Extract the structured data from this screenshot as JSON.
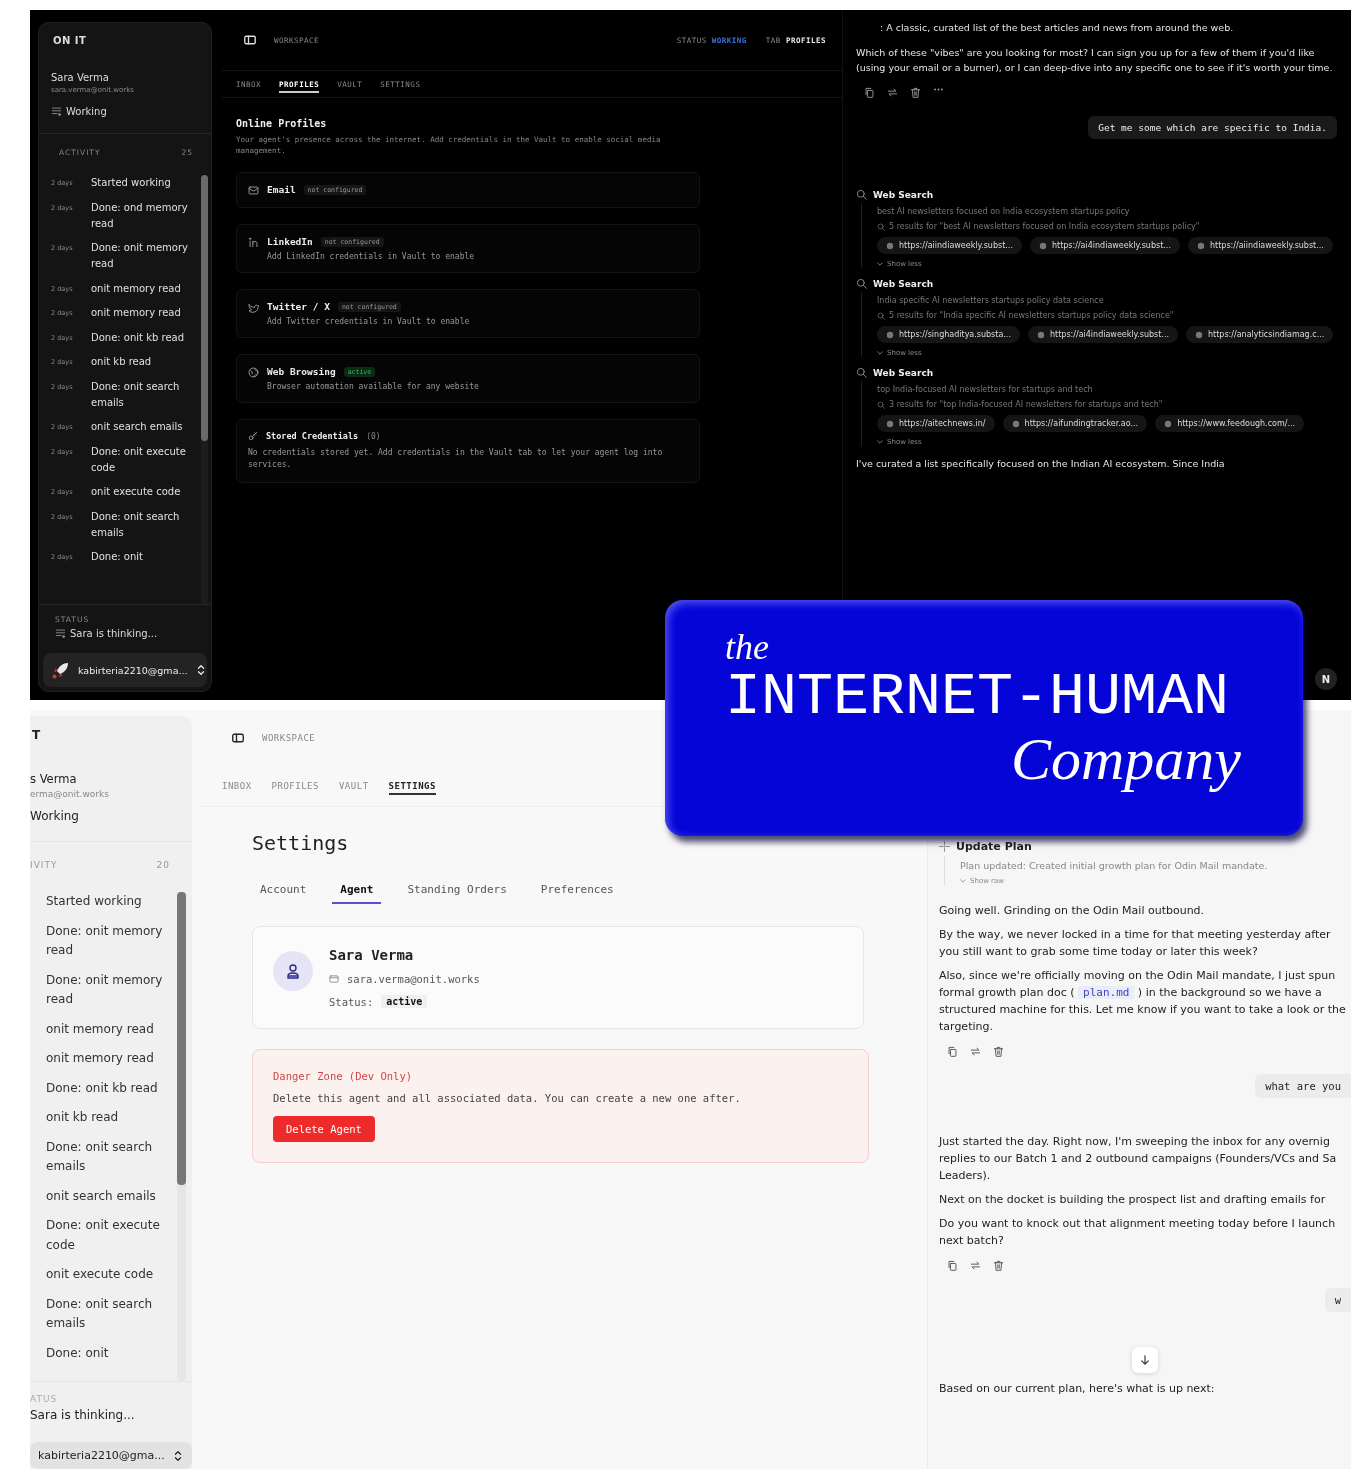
{
  "dark_screen": {
    "sidebar": {
      "brand": "ON IT",
      "user_name": "Sara Verma",
      "user_email": "sara.verma@onit.works",
      "user_status": "Working",
      "activity_title": "ACTIVITY",
      "activity_count": "25",
      "activity": [
        {
          "time": "2 days",
          "text": "Started working"
        },
        {
          "time": "2 days",
          "text": "Done: ond memory read"
        },
        {
          "time": "2 days",
          "text": "Done: onit memory read"
        },
        {
          "time": "2 days",
          "text": "onit memory read"
        },
        {
          "time": "2 days",
          "text": "onit memory read"
        },
        {
          "time": "2 days",
          "text": "Done: onit kb read"
        },
        {
          "time": "2 days",
          "text": "onit kb read"
        },
        {
          "time": "2 days",
          "text": "Done: onit search emails"
        },
        {
          "time": "2 days",
          "text": "onit search emails"
        },
        {
          "time": "2 days",
          "text": "Done: onit execute code"
        },
        {
          "time": "2 days",
          "text": "onit execute code"
        },
        {
          "time": "2 days",
          "text": "Done: onit search emails"
        },
        {
          "time": "2 days",
          "text": "Done: onit"
        }
      ],
      "status_title": "STATUS",
      "status_text": "Sara is thinking...",
      "account": "kabirteria2210@gma..."
    },
    "header": {
      "title": "WORKSPACE",
      "status_label": "STATUS",
      "status_value": "WORKING",
      "tab_label": "TAB",
      "tab_value": "PROFILES"
    },
    "tabs": [
      {
        "label": "INBOX",
        "selected": false
      },
      {
        "label": "PROFILES",
        "selected": true
      },
      {
        "label": "VAULT",
        "selected": false
      },
      {
        "label": "SETTINGS",
        "selected": false
      }
    ],
    "profiles": {
      "title": "Online Profiles",
      "description": "Your agent's presence across the internet. Add credentials in the Vault to enable social media management.",
      "cards": [
        {
          "name": "Email",
          "badge": "not configured",
          "active": false
        },
        {
          "name": "LinkedIn",
          "badge": "not configured",
          "active": false,
          "note": "Add LinkedIn credentials in Vault to enable"
        },
        {
          "name": "Twitter / X",
          "badge": "not configured",
          "active": false,
          "note": "Add Twitter credentials in Vault to enable"
        },
        {
          "name": "Web Browsing",
          "badge": "active",
          "active": true,
          "note": "Browser automation available for any website"
        }
      ],
      "credentials": {
        "title": "Stored Credentials",
        "count": "(0)",
        "text": "No credentials stored yet. Add credentials in the Vault tab to let your agent log into services."
      }
    },
    "chat": {
      "items": [
        {
          "kind": "list_line",
          "text": ": A classic, curated list of the best articles and news from around the web."
        },
        {
          "kind": "text",
          "text": "Which of these \"vibes\" are you looking for most? I can sign you up for a few of them if you'd like (using your email or a burner), or I can deep-dive into any specific one to see if it's worth your time."
        },
        {
          "kind": "actions",
          "more": true
        },
        {
          "kind": "user",
          "text": "Get me some which are specific to India."
        },
        {
          "kind": "search",
          "title": "Web Search",
          "query": "best AI newsletters focused on India ecosystem startups policy",
          "results": "5 results for \"best AI newsletters focused on India ecosystem startups policy\"",
          "links": [
            "https://aiindiaweekly.subst...",
            "https://ai4indiaweekly.subst...",
            "https://aiindiaweekly.subst..."
          ],
          "toggle": "Show less"
        },
        {
          "kind": "search",
          "title": "Web Search",
          "query": "India specific AI newsletters startups policy data science",
          "results": "5 results for \"India specific AI newsletters startups policy data science\"",
          "links": [
            "https://singhaditya.substa...",
            "https://ai4indiaweekly.subst...",
            "https://analyticsindiamag.c..."
          ],
          "toggle": "Show less"
        },
        {
          "kind": "search",
          "title": "Web Search",
          "query": "top India-focused AI newsletters for startups and tech",
          "results": "3 results for \"top India-focused AI newsletters for startups and tech\"",
          "links": [
            "https://aitechnews.in/",
            "https://aifundingtracker.ao...",
            "https://www.feedough.com/..."
          ],
          "toggle": "Show less"
        },
        {
          "kind": "text",
          "text": "I've curated a list specifically focused on the Indian AI ecosystem. Since India"
        }
      ]
    },
    "avatar_button": "N"
  },
  "light_screen": {
    "sidebar": {
      "brand": "T",
      "user_name": "s Verma",
      "user_email": "erma@onit.works",
      "user_status": "Working",
      "activity_title": "IVITY",
      "activity_count": "20",
      "activity": [
        {
          "text": "Started working"
        },
        {
          "text": "Done: onit memory read"
        },
        {
          "text": "Done: onit memory read"
        },
        {
          "text": "onit memory read"
        },
        {
          "text": "onit memory read"
        },
        {
          "text": "Done: onit kb read"
        },
        {
          "text": "onit kb read"
        },
        {
          "text": "Done: onit search emails"
        },
        {
          "text": "onit search emails"
        },
        {
          "text": "Done: onit execute code"
        },
        {
          "text": "onit execute code"
        },
        {
          "text": "Done: onit search emails"
        },
        {
          "text": "Done: onit"
        }
      ],
      "status_title": "ATUS",
      "status_text": "Sara is thinking...",
      "account": "kabirteria2210@gma..."
    },
    "header": {
      "title": "WORKSPACE"
    },
    "tabs": [
      {
        "label": "INBOX",
        "selected": false
      },
      {
        "label": "PROFILES",
        "selected": false
      },
      {
        "label": "VAULT",
        "selected": false
      },
      {
        "label": "SETTINGS",
        "selected": true
      }
    ],
    "settings": {
      "title": "Settings",
      "tabs": [
        {
          "label": "Account",
          "selected": false
        },
        {
          "label": "Agent",
          "selected": true
        },
        {
          "label": "Standing Orders",
          "selected": false
        },
        {
          "label": "Preferences",
          "selected": false
        }
      ],
      "agent": {
        "name": "Sara Verma",
        "email": "sara.verma@onit.works",
        "status_label": "Status:",
        "status_value": "active"
      },
      "danger": {
        "title": "Danger Zone (Dev Only)",
        "text": "Delete this agent and all associated data. You can create a new one after.",
        "button": "Delete Agent"
      }
    },
    "chat": {
      "items": [
        {
          "kind": "plan",
          "title": "Update Plan",
          "text": "Plan updated: Created initial growth plan for Odin Mail mandate.",
          "toggle": "Show raw"
        },
        {
          "kind": "text",
          "text": "Going well. Grinding on the Odin Mail outbound."
        },
        {
          "kind": "text",
          "text": "By the way, we never locked in a time for that meeting yesterday after you still want to grab some time today or later this week?"
        },
        {
          "kind": "text_code",
          "before": "Also, since we're officially moving on the Odin Mail mandate, I just spun formal growth plan doc (",
          "code": "plan.md",
          "after": ") in the background so we have a structured machine for this. Let me know if you want to take a look or the targeting."
        },
        {
          "kind": "actions",
          "more": false
        },
        {
          "kind": "user",
          "text": "what are you"
        },
        {
          "kind": "text",
          "text": "Just started the day. Right now, I'm sweeping the inbox for any overnig replies to our Batch 1 and 2 outbound campaigns (Founders/VCs and Sa Leaders)."
        },
        {
          "kind": "text",
          "text": "Next on the docket is building the prospect list and drafting emails for"
        },
        {
          "kind": "text",
          "text": "Do you want to knock out that alignment meeting today before I launch next batch?"
        },
        {
          "kind": "actions",
          "more": false
        },
        {
          "kind": "user",
          "text": "w"
        },
        {
          "kind": "scroll_down"
        },
        {
          "kind": "text",
          "text": "Based on our current plan, here's what is up next:"
        }
      ]
    }
  },
  "logo": {
    "the": "the",
    "name": "INTERNET-HUMAN",
    "company": "Company"
  }
}
